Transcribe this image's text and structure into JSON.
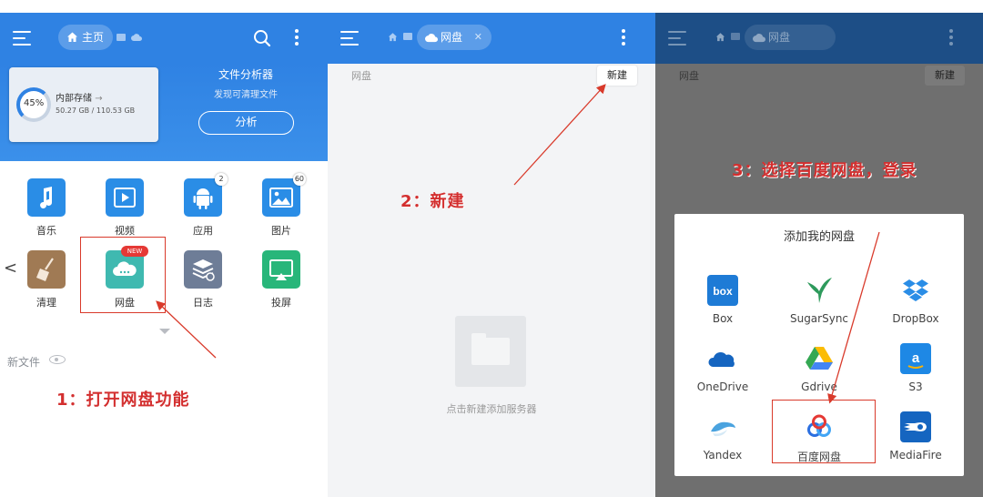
{
  "panel1": {
    "topbar": {
      "home_label": "主页"
    },
    "storage": {
      "percent_label": "45%",
      "name": "内部存储",
      "arrow": "→",
      "size": "50.27 GB / 110.53 GB"
    },
    "analyzer": {
      "title": "文件分析器",
      "subtitle": "发现可清理文件",
      "button": "分析"
    },
    "apps": [
      {
        "label": "音乐",
        "icon": "music-icon",
        "color": "#2a8de6"
      },
      {
        "label": "视频",
        "icon": "video-icon",
        "color": "#2a8de6"
      },
      {
        "label": "应用",
        "icon": "android-icon",
        "color": "#2a8de6",
        "badge": "2"
      },
      {
        "label": "图片",
        "icon": "picture-icon",
        "color": "#2a8de6",
        "badge": "60"
      },
      {
        "label": "清理",
        "icon": "broom-icon",
        "color": "#a07a54"
      },
      {
        "label": "网盘",
        "icon": "cloud-drive-icon",
        "color": "#3fb9b0",
        "new_badge": "NEW"
      },
      {
        "label": "日志",
        "icon": "log-icon",
        "color": "#6e7d97"
      },
      {
        "label": "投屏",
        "icon": "cast-icon",
        "color": "#28b67a"
      }
    ],
    "recent_label": "新文件",
    "annotation": "1：打开网盘功能"
  },
  "panel2": {
    "topbar": {
      "tab_label": "网盘",
      "close": "✕"
    },
    "section_label": "网盘",
    "new_button": "新建",
    "empty_hint": "点击新建添加服务器",
    "annotation": "2：新建"
  },
  "panel3": {
    "topbar": {
      "tab_label": "网盘"
    },
    "section_label": "网盘",
    "new_button": "新建",
    "annotation": "3：选择百度网盘，登录",
    "dialog": {
      "title": "添加我的网盘",
      "services": [
        {
          "label": "Box",
          "icon": "box-icon",
          "color": "#1e7bd6"
        },
        {
          "label": "SugarSync",
          "icon": "sugarsync-icon",
          "color": "#2e9a5c"
        },
        {
          "label": "DropBox",
          "icon": "dropbox-icon",
          "color": "#2a8de6"
        },
        {
          "label": "OneDrive",
          "icon": "onedrive-icon",
          "color": "#1565c0"
        },
        {
          "label": "Gdrive",
          "icon": "gdrive-icon",
          "color": "#34a853"
        },
        {
          "label": "S3",
          "icon": "s3-icon",
          "color": "#1e88e5"
        },
        {
          "label": "Yandex",
          "icon": "yandex-icon",
          "color": "#4aa3df"
        },
        {
          "label": "百度网盘",
          "icon": "baidu-pan-icon",
          "color": "#2b6fe0"
        },
        {
          "label": "MediaFire",
          "icon": "mediafire-icon",
          "color": "#1565c0"
        }
      ]
    }
  }
}
